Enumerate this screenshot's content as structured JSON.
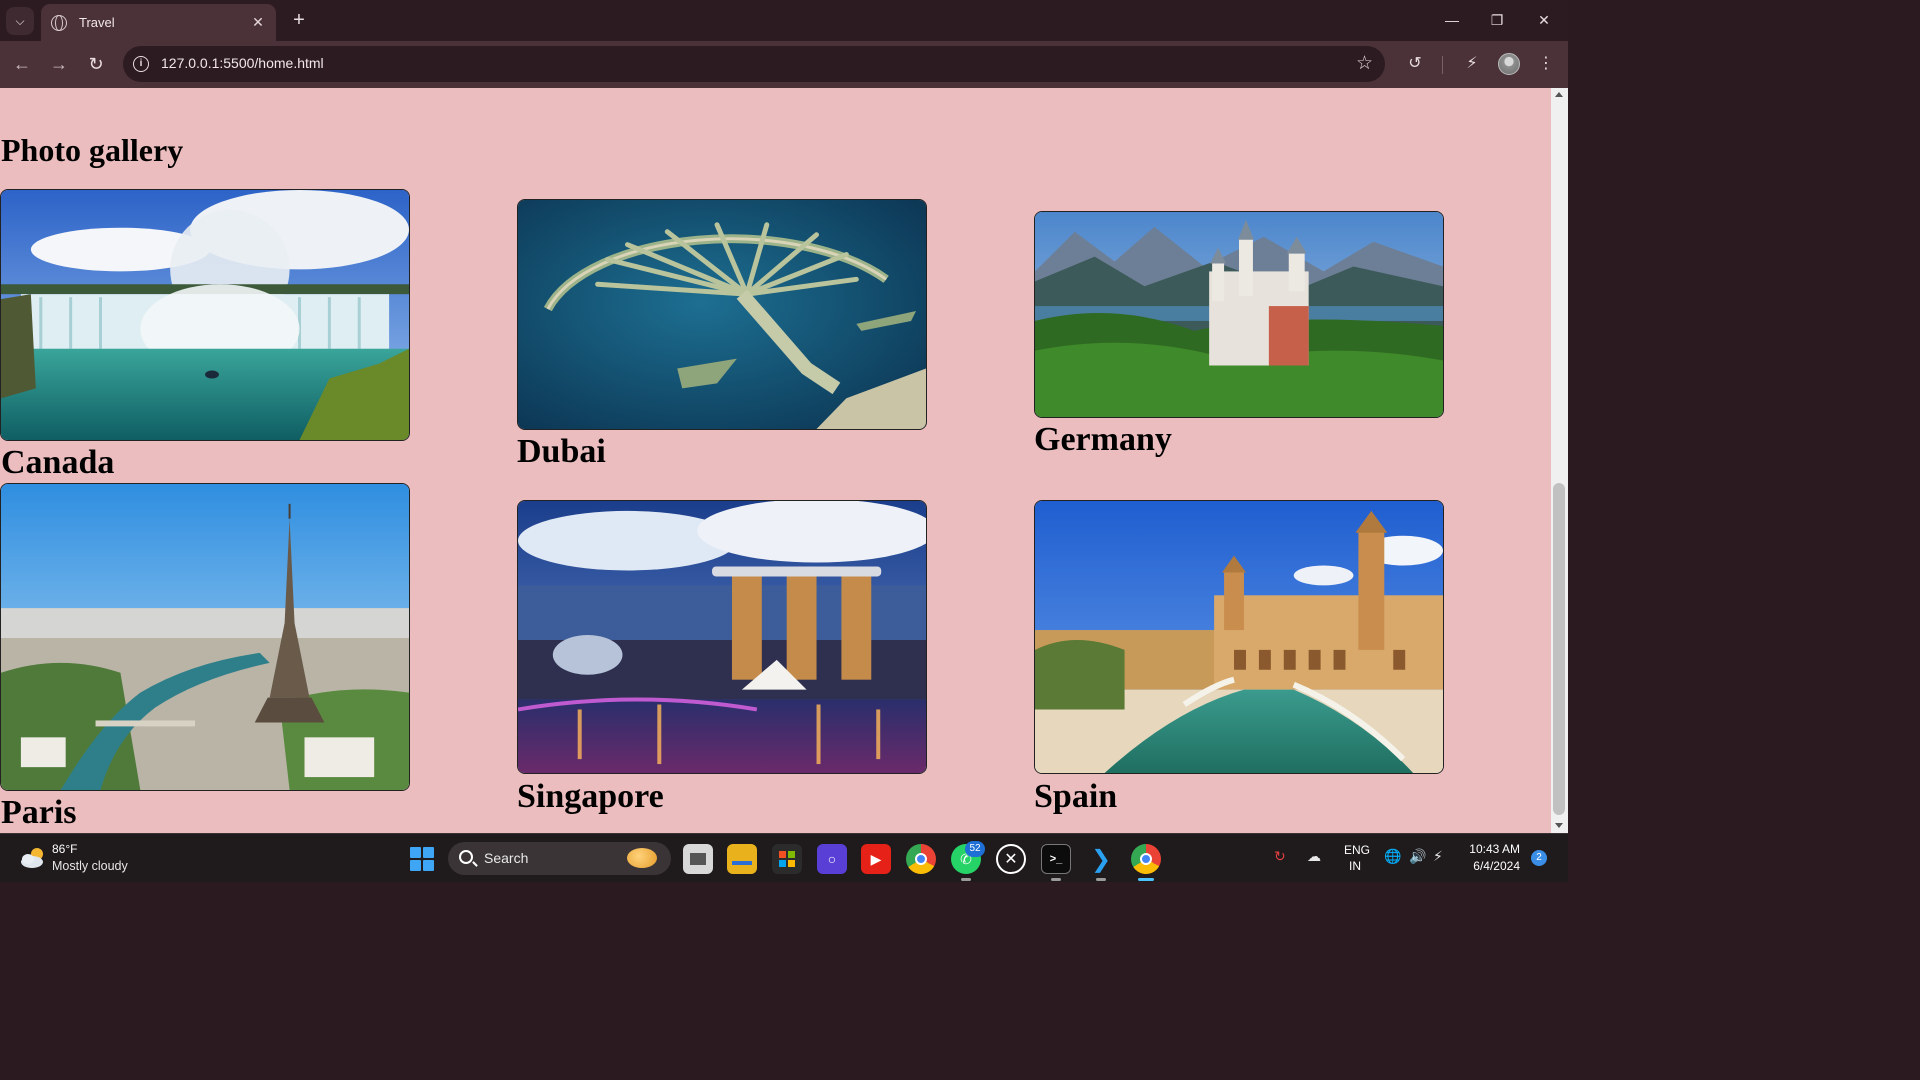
{
  "browser": {
    "tab_title": "Travel",
    "url": "127.0.0.1:5500/home.html"
  },
  "page": {
    "heading": "Photo gallery",
    "gallery": [
      {
        "caption": "Canada",
        "scene": "niagara-falls-waterfall"
      },
      {
        "caption": "Dubai",
        "scene": "palm-island-aerial"
      },
      {
        "caption": "Germany",
        "scene": "neuschwanstein-castle"
      },
      {
        "caption": "Paris",
        "scene": "eiffel-tower-city"
      },
      {
        "caption": "Singapore",
        "scene": "marina-bay-sands-night"
      },
      {
        "caption": "Spain",
        "scene": "plaza-de-espana"
      }
    ],
    "background_color": "#ebbdbe"
  },
  "taskbar": {
    "weather_temp": "86°F",
    "weather_desc": "Mostly cloudy",
    "search_label": "Search",
    "whatsapp_badge": "52",
    "lang_line1": "ENG",
    "lang_line2": "IN",
    "time": "10:43 AM",
    "date": "6/4/2024",
    "notification_count": "2"
  }
}
